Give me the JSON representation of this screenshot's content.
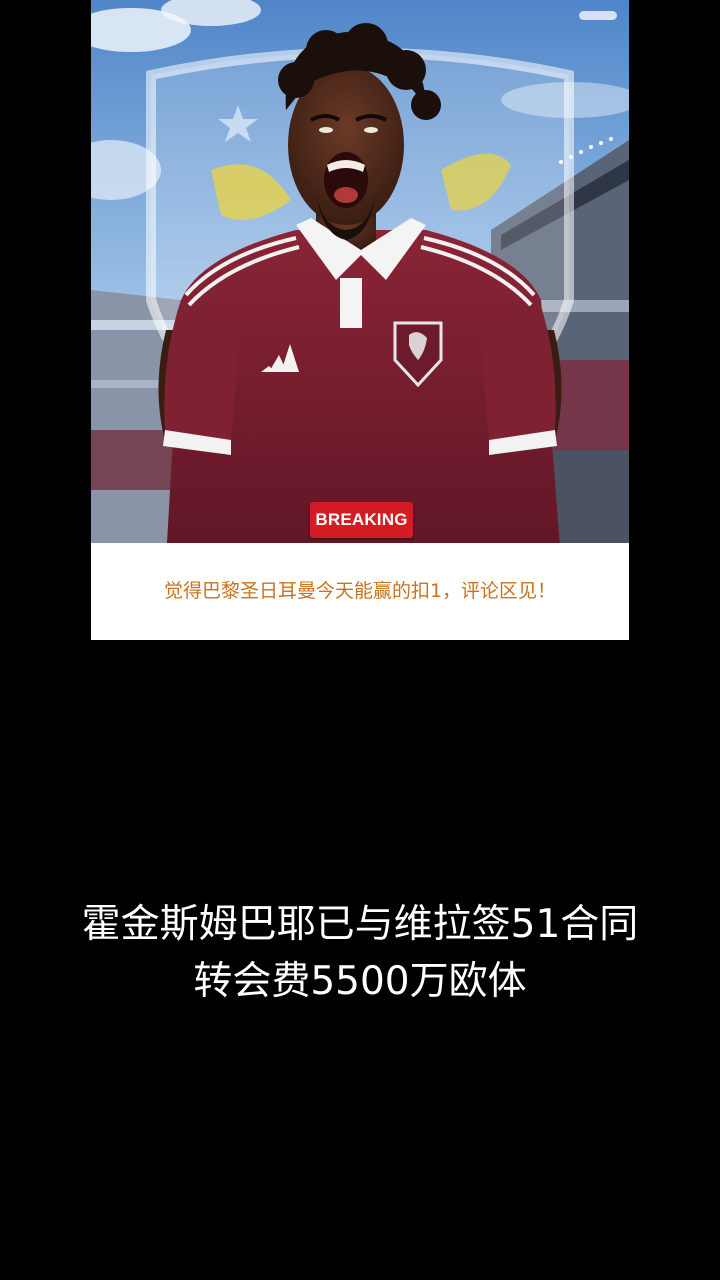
{
  "post": {
    "image_alt": "Football player in claret Aston Villa kit shouting in stadium",
    "corner_badge": "",
    "breaking_label": "BREAKING",
    "caption": "觉得巴黎圣日耳曼今天能赢的扣1，评论区见！"
  },
  "subtitles": {
    "line1": "霍金斯姆巴耶已与维拉签51合同",
    "line2": "转会费5500万欧体"
  },
  "colors": {
    "background": "#000000",
    "caption_text": "#c8741e",
    "breaking_bg": "#d41c24",
    "jersey": "#7a1f33",
    "sky": "#6f9fd4"
  }
}
